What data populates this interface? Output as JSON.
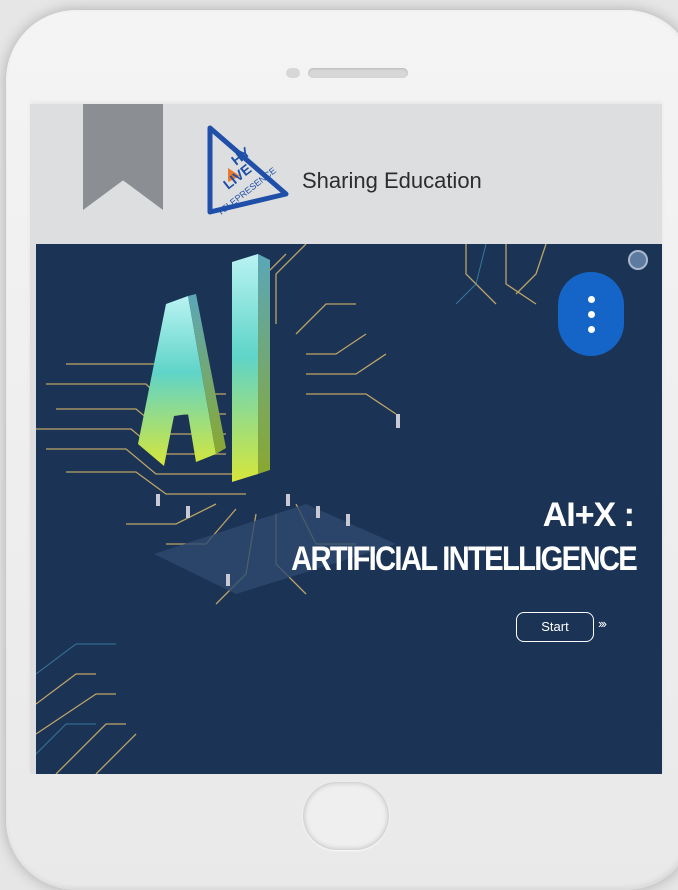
{
  "header": {
    "title": "Sharing Education",
    "logo_text_top": "HY",
    "logo_text_mid": "LIVE",
    "logo_text_bottom": "TELEPRESENCE"
  },
  "banner": {
    "hero_letters": "AI",
    "headline_line1": "AI+X :",
    "headline_line2": "ARTIFICIAL INTELLIGENCE",
    "start_label": "Start",
    "start_chevrons": "›››"
  },
  "colors": {
    "banner_bg": "#1b3355",
    "menu_button": "#1565c9",
    "logo_blue": "#1f4fa8",
    "logo_orange": "#e8782a"
  },
  "icons": {
    "menu": "kebab-menu-icon",
    "bookmark": "bookmark-icon",
    "chat": "chat-icon"
  }
}
